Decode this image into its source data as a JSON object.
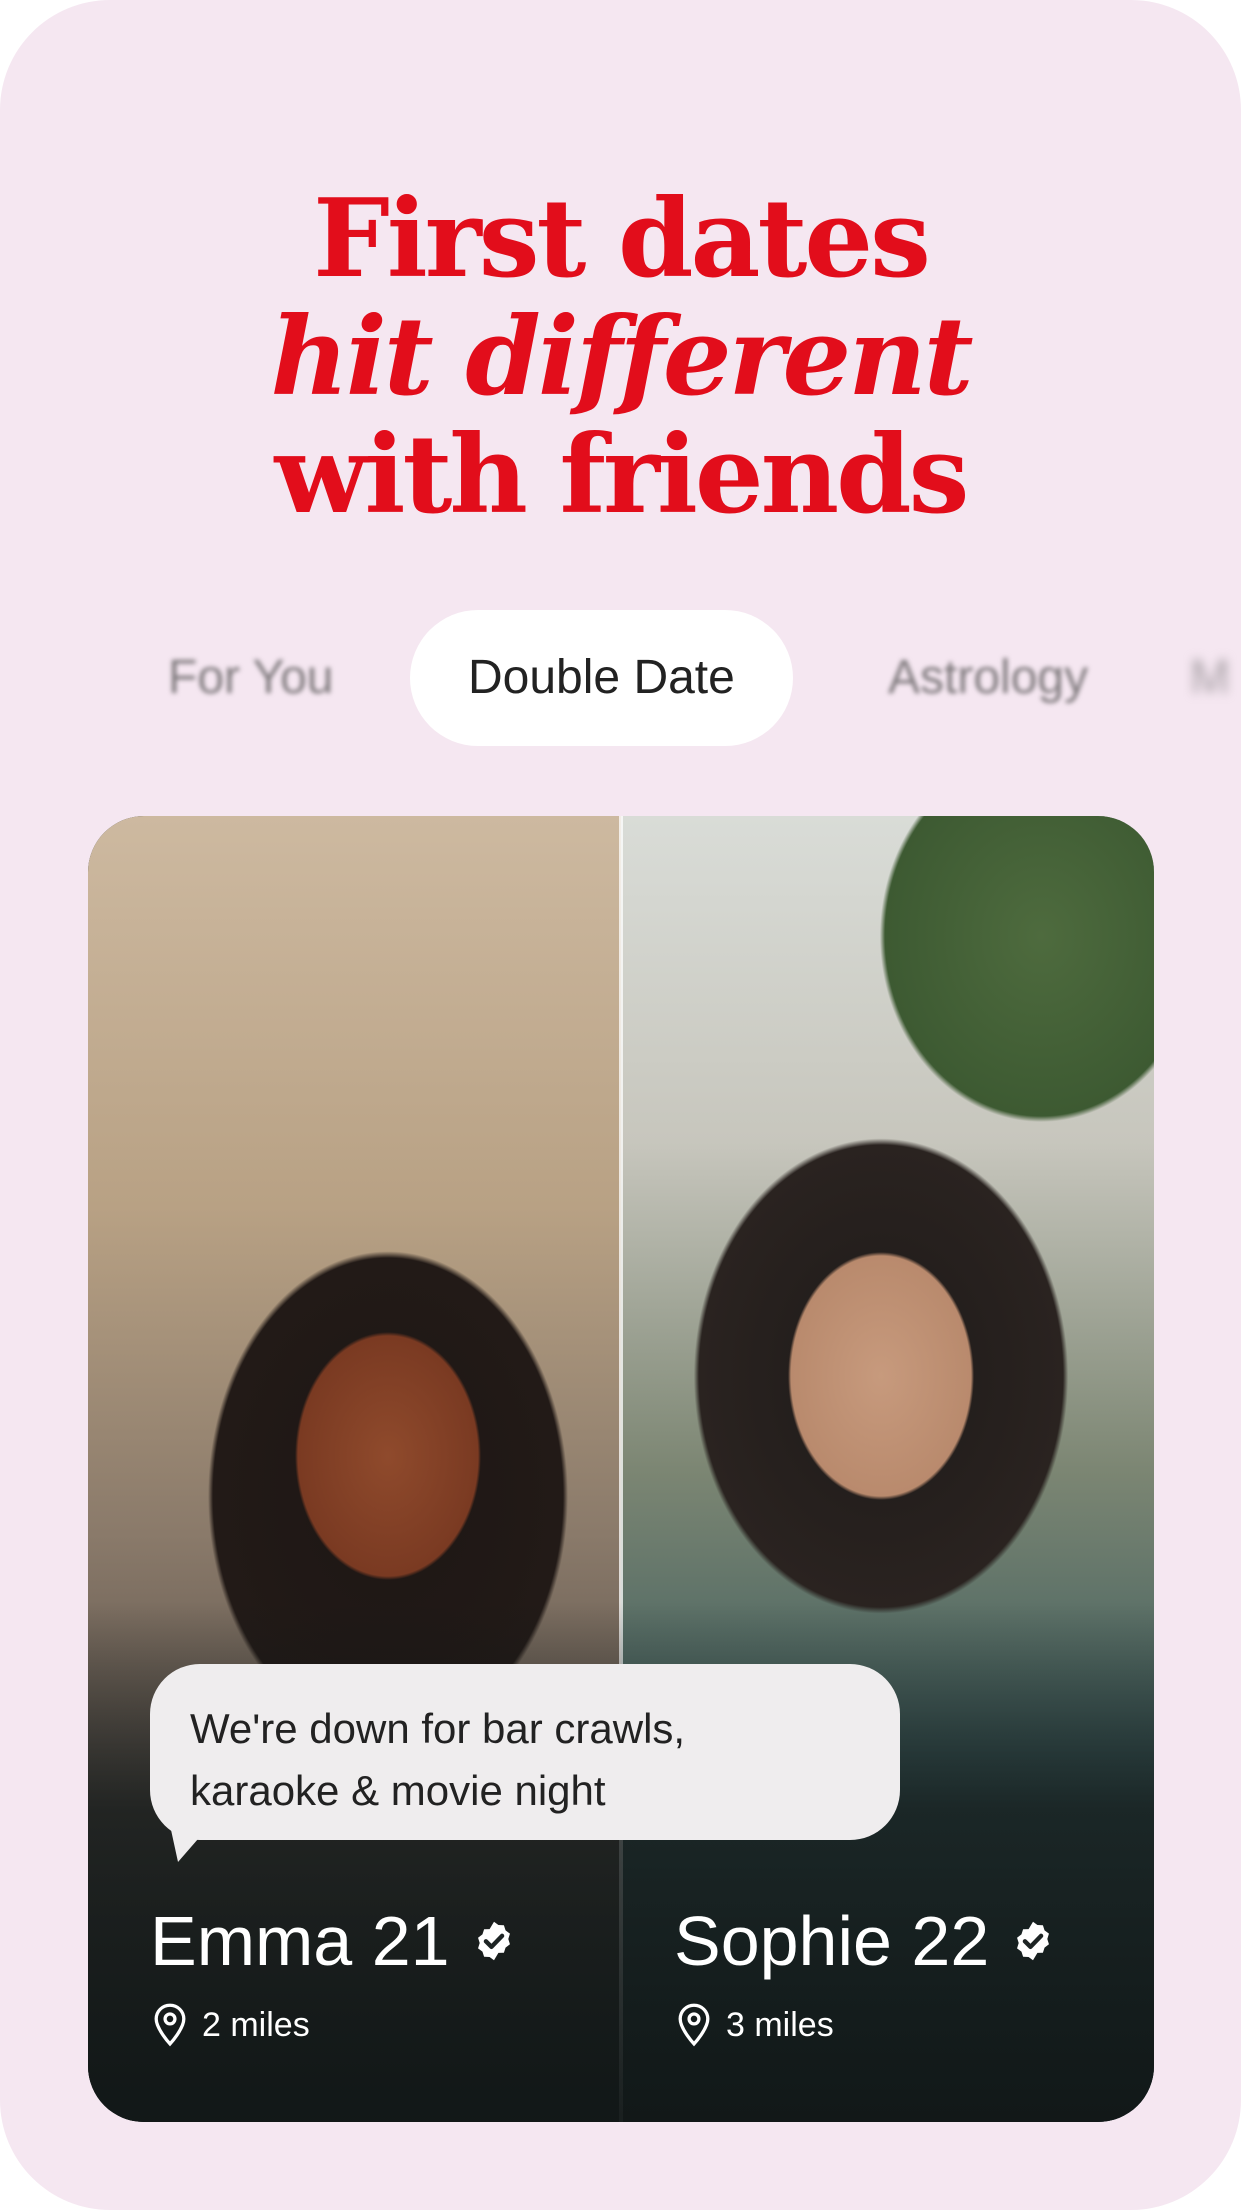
{
  "headline": {
    "line1": "First dates",
    "line2": "hit different",
    "line3": "with friends"
  },
  "tabs": [
    {
      "label": "For You"
    },
    {
      "label": "Double Date"
    },
    {
      "label": "Astrology"
    },
    {
      "label": "M"
    }
  ],
  "active_tab": "Double Date",
  "card": {
    "bubble_text_line1": "We're down for bar crawls,",
    "bubble_text_line2": "karaoke & movie night",
    "profiles": [
      {
        "name": "Emma 21",
        "distance": "2 miles"
      },
      {
        "name": "Sophie 22",
        "distance": "3 miles"
      }
    ]
  },
  "colors": {
    "background": "#f5e7f1",
    "headline": "#e20d1b",
    "tab_active_bg": "#ffffff",
    "bubble_bg": "#efedee"
  }
}
